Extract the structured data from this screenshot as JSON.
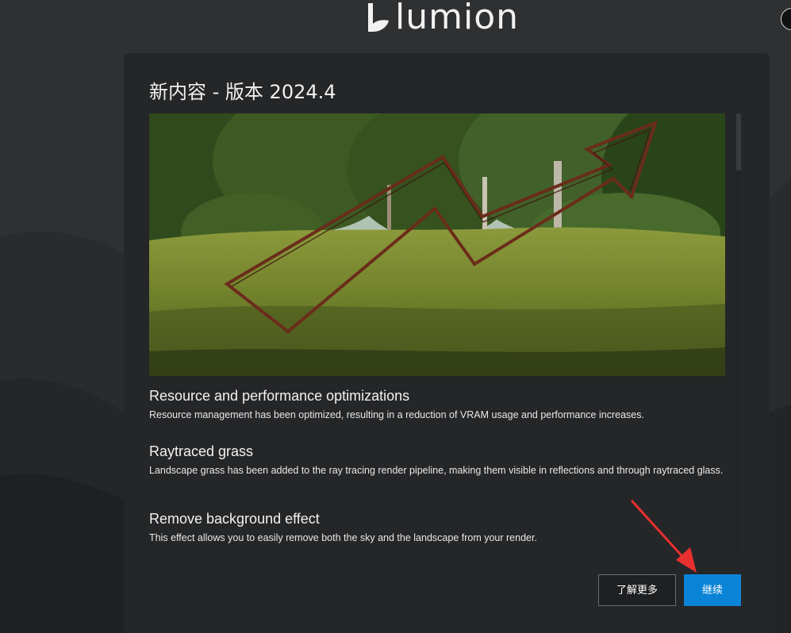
{
  "brand": {
    "name": "lumion"
  },
  "dialog": {
    "title": "新内容 - 版本 2024.4",
    "features": [
      {
        "title": "Resource and performance optimizations",
        "description": "Resource management has been optimized, resulting in a reduction of VRAM usage and performance increases."
      },
      {
        "title": "Raytraced grass",
        "description": "Landscape grass has been added to the ray tracing render pipeline, making them visible in reflections and through raytraced glass."
      },
      {
        "title": "Remove background effect",
        "description": "This effect allows you to easily remove both the sky and the landscape from your render."
      }
    ],
    "buttons": {
      "learn_more": "了解更多",
      "continue": "继续"
    }
  },
  "colors": {
    "background": "#2d2e30",
    "dialog": "#252628",
    "accent": "#0a84d6",
    "annotation_arrow": "#e8302f"
  },
  "icons": {
    "logo": "lumion-logo-icon",
    "hero": "growth-arrow-sculpture-image",
    "annotation": "red-pointer-arrow-icon"
  }
}
